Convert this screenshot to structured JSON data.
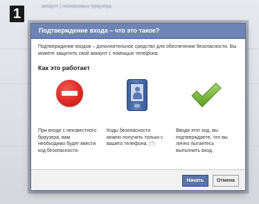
{
  "step": "1",
  "background": {
    "top_text": "аккаунт | незнакомых браузера"
  },
  "dialog": {
    "title": "Подтверждение входа – что это такое?",
    "intro": "Подтверждение входов – дополнительное средство для обеспечения безопасности. Вы можете защитить свой аккаунт с помощью телефона.",
    "how_title": "Как это работает",
    "columns": [
      {
        "icon": "stop-icon",
        "text": "При входе с неизвестного браузера, вам необходимо будет ввести код безопасности."
      },
      {
        "icon": "phone-icon",
        "text": "Коды безопасности можно получить только с вашего телефона.",
        "help": "(?)"
      },
      {
        "icon": "checkmark-icon",
        "text": "Вводя этот код, вы подтверждаете, что вы лично пытаетесь выполнить вход."
      }
    ],
    "buttons": {
      "start": "Начать",
      "cancel": "Отмена"
    }
  },
  "colors": {
    "header": "#6d84b4",
    "primary_button": "#5b74a8",
    "stop": "#dc2a26",
    "check": "#7ab43a"
  }
}
